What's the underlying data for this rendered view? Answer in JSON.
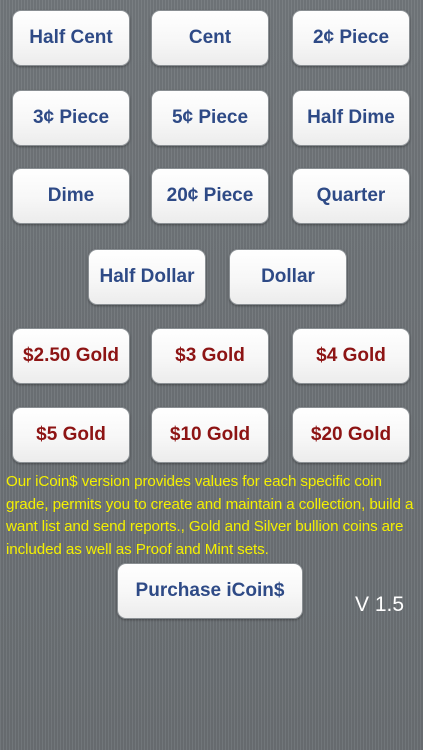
{
  "coins": {
    "half_cent": "Half Cent",
    "cent": "Cent",
    "two_cent": "2¢ Piece",
    "three_cent": "3¢ Piece",
    "five_cent": "5¢ Piece",
    "half_dime": "Half Dime",
    "dime": "Dime",
    "twenty_cent": "20¢ Piece",
    "quarter": "Quarter",
    "half_dollar": "Half Dollar",
    "dollar": "Dollar"
  },
  "gold": {
    "g250": "$2.50 Gold",
    "g3": "$3 Gold",
    "g4": "$4 Gold",
    "g5": "$5 Gold",
    "g10": "$10 Gold",
    "g20": "$20 Gold"
  },
  "info_text": "Our iCoin$ version provides values for each specific coin grade, permits you to create and maintain a collection, build a want list and send reports., Gold and Silver bullion coins are included as well as Proof and Mint sets.",
  "purchase_label": "Purchase iCoin$",
  "version": "V 1.5",
  "colors": {
    "standard_text": "#2e4a86",
    "gold_text": "#8d1414",
    "info_text": "#f4f000",
    "background": "#6f7478"
  }
}
